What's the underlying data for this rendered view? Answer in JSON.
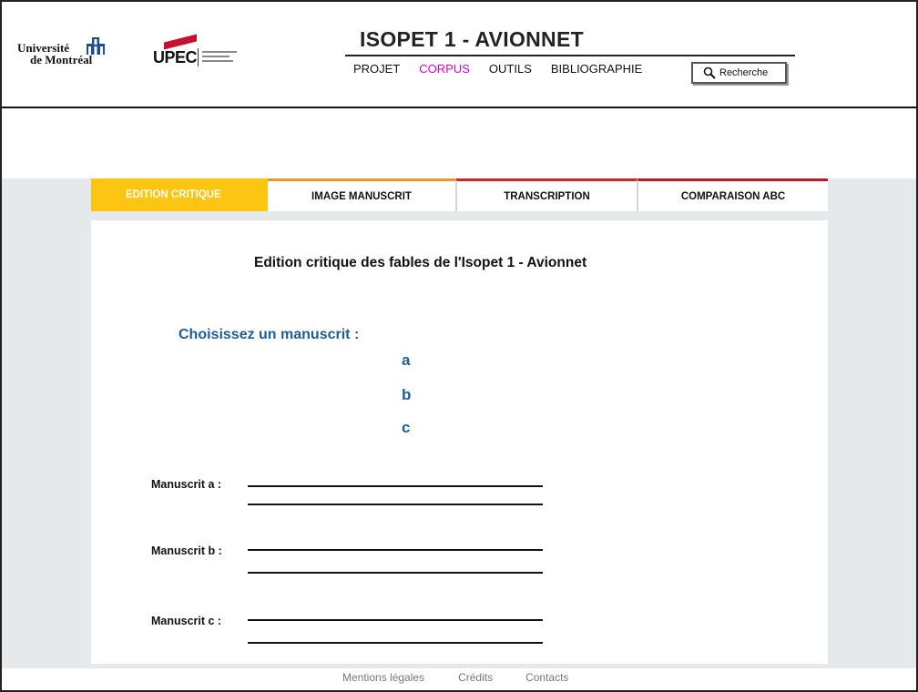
{
  "header": {
    "udem_logo": {
      "line1": "Université",
      "line2": "de Montréal"
    },
    "upec_logo": {
      "text": "UPEC"
    },
    "site_title": "ISOPET 1 - AVIONNET",
    "nav": [
      {
        "label": "PROJET",
        "active": false
      },
      {
        "label": "CORPUS",
        "active": true
      },
      {
        "label": "OUTILS",
        "active": false
      },
      {
        "label": "BIBLIOGRAPHIE",
        "active": false
      }
    ],
    "search": {
      "label": "Recherche",
      "icon": "search-icon"
    }
  },
  "tabs": [
    {
      "label": "EDITION CRITIQUE",
      "color": "#fcc512",
      "active": true
    },
    {
      "label": "IMAGE MANUSCRIT",
      "color": "#f7931e",
      "active": false
    },
    {
      "label": "TRANSCRIPTION",
      "color": "#d7231f",
      "active": false
    },
    {
      "label": "COMPARAISON ABC",
      "color": "#c4161c",
      "active": false
    }
  ],
  "main": {
    "title": "Edition critique des fables de l'Isopet 1 - Avionnet",
    "choose_label": "Choisissez un manuscrit :",
    "manuscripts": [
      "a",
      "b",
      "c"
    ],
    "rows": [
      {
        "label": "Manuscrit a :"
      },
      {
        "label": "Manuscrit b :"
      },
      {
        "label": "Manuscrit c :"
      }
    ]
  },
  "footer": {
    "links": [
      "Mentions légales",
      "Crédits",
      "Contacts"
    ]
  },
  "colors": {
    "active_nav": "#e000d0",
    "link_blue": "#1d5d99",
    "background": "#e6e9ec"
  }
}
